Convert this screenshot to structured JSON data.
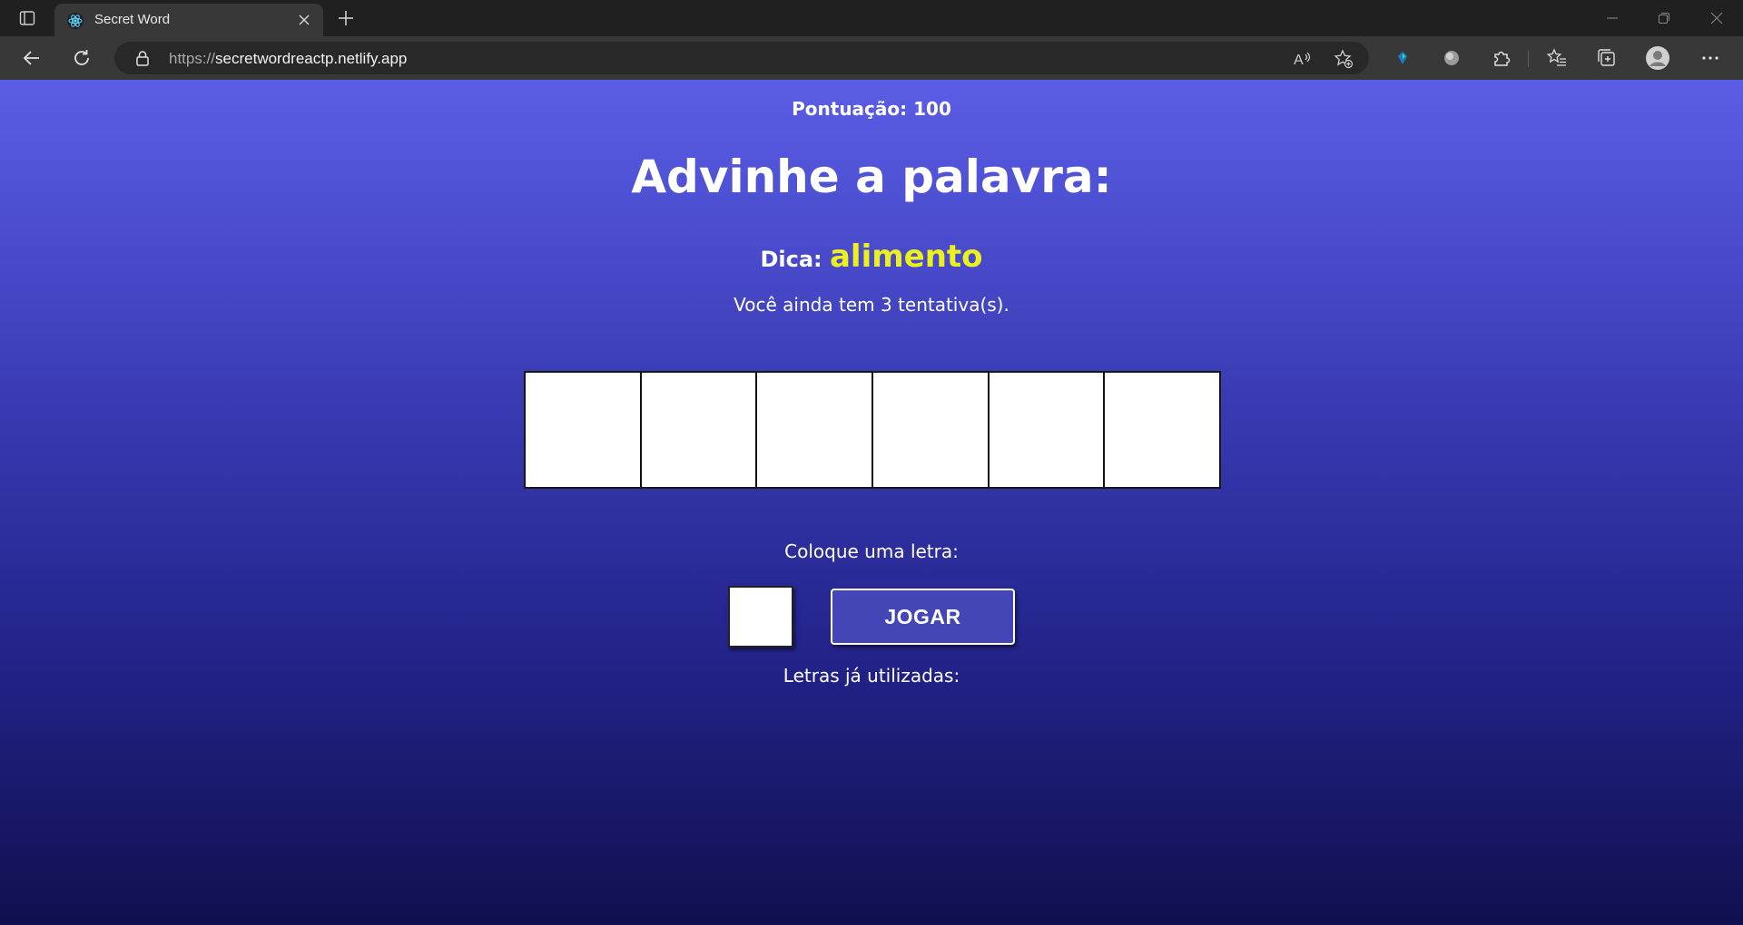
{
  "browser": {
    "tab_title": "Secret Word",
    "url_scheme": "https://",
    "url_host": "secretwordreactp.netlify.app",
    "accent_color": "#5b5ee6"
  },
  "game": {
    "score_text": "Pontuação: 100",
    "heading": "Advinhe a palavra:",
    "tip_label": "Dica:",
    "tip_word": "alimento",
    "guesses_text": "Você ainda tem 3 tentativa(s).",
    "letter_boxes": 6,
    "input_prompt": "Coloque uma letra:",
    "letter_input_value": "",
    "play_button_label": "JOGAR",
    "used_letters_label": "Letras já utilizadas:"
  },
  "colors": {
    "tip_word": "#ecf01e",
    "button_bg": "#4446b8"
  }
}
